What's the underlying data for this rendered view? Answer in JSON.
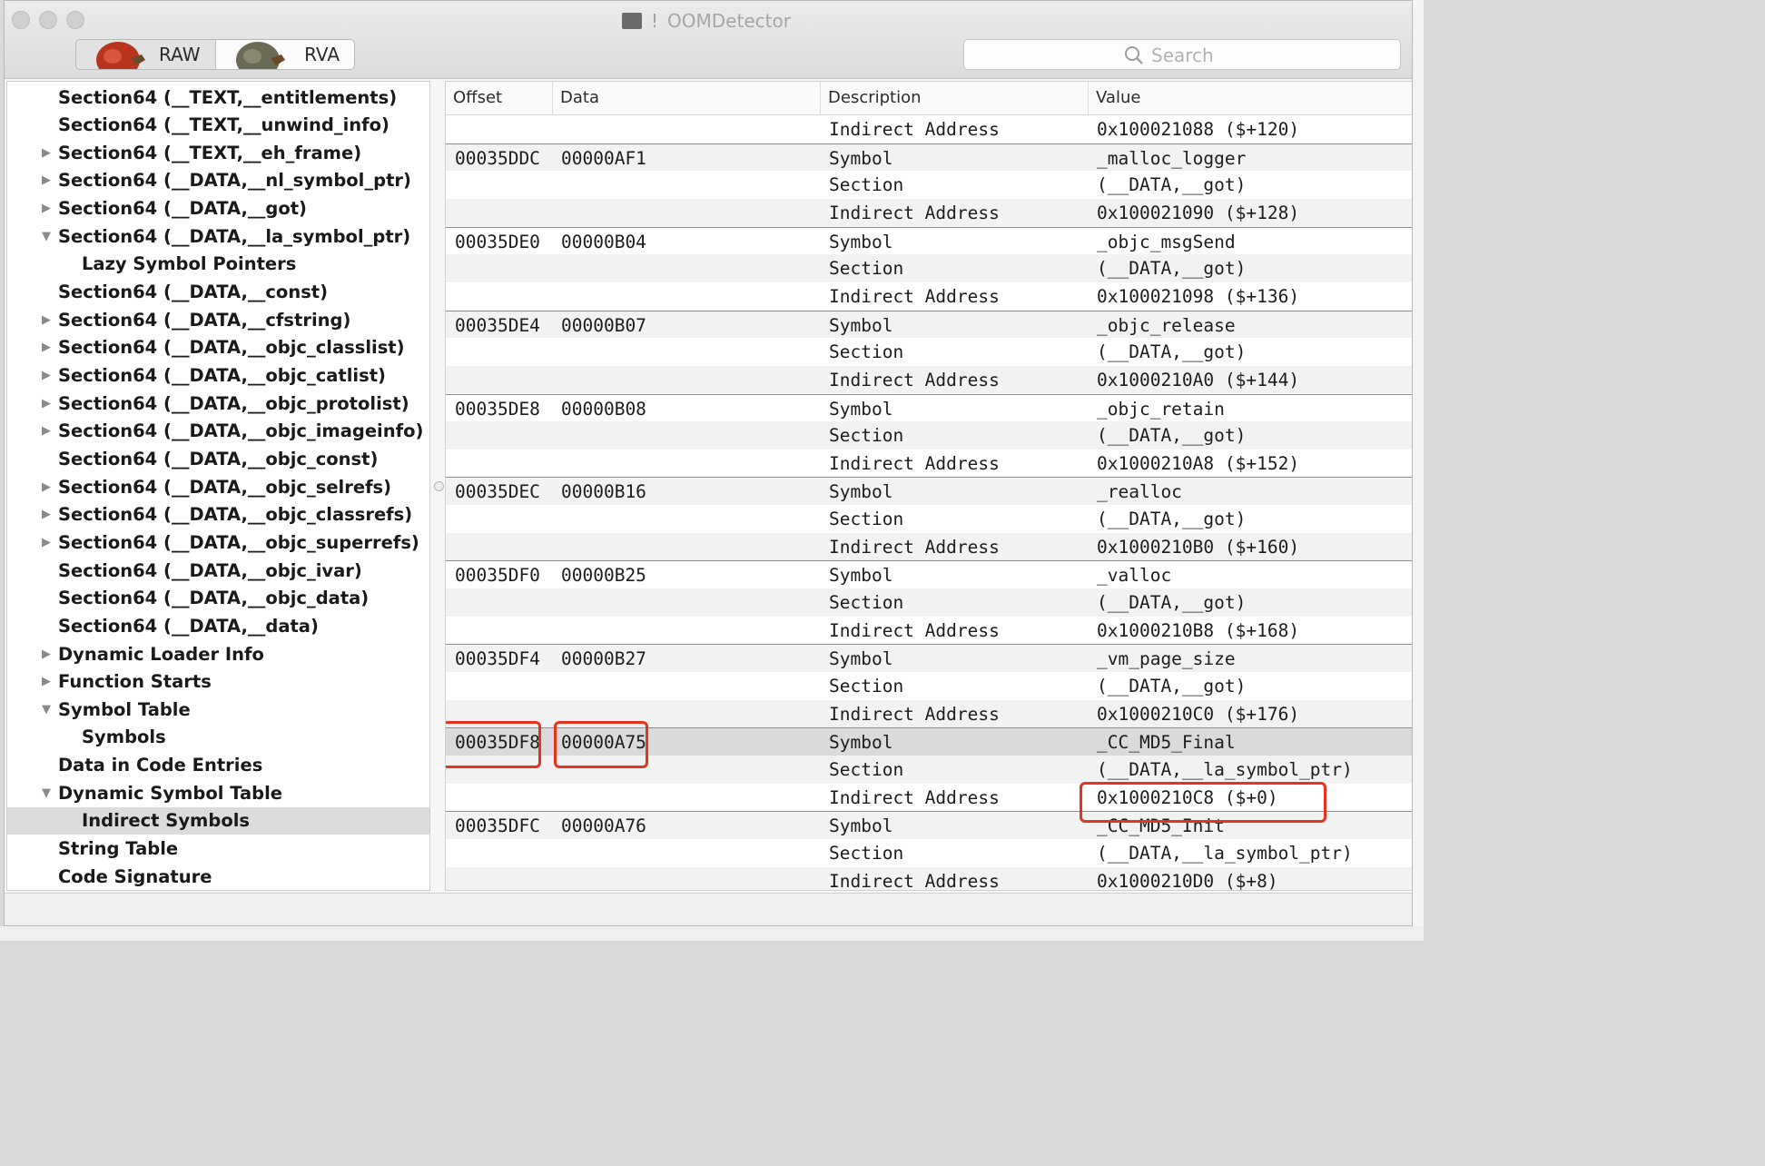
{
  "window": {
    "title": "OOMDetector",
    "title_mark": "!"
  },
  "toolbar": {
    "segments": [
      {
        "label": "RAW",
        "selected": true
      },
      {
        "label": "RVA",
        "selected": false
      }
    ],
    "search_placeholder": "Search"
  },
  "sidebar": {
    "items": [
      {
        "label": "Section64 (__TEXT,__entitlements)",
        "indent": 1,
        "disclosure": "none"
      },
      {
        "label": "Section64 (__TEXT,__unwind_info)",
        "indent": 1,
        "disclosure": "none"
      },
      {
        "label": "Section64 (__TEXT,__eh_frame)",
        "indent": 1,
        "disclosure": "collapsed"
      },
      {
        "label": "Section64 (__DATA,__nl_symbol_ptr)",
        "indent": 1,
        "disclosure": "collapsed"
      },
      {
        "label": "Section64 (__DATA,__got)",
        "indent": 1,
        "disclosure": "collapsed"
      },
      {
        "label": "Section64 (__DATA,__la_symbol_ptr)",
        "indent": 1,
        "disclosure": "expanded"
      },
      {
        "label": "Lazy Symbol Pointers",
        "indent": 2,
        "disclosure": "none"
      },
      {
        "label": "Section64 (__DATA,__const)",
        "indent": 1,
        "disclosure": "none"
      },
      {
        "label": "Section64 (__DATA,__cfstring)",
        "indent": 1,
        "disclosure": "collapsed"
      },
      {
        "label": "Section64 (__DATA,__objc_classlist)",
        "indent": 1,
        "disclosure": "collapsed"
      },
      {
        "label": "Section64 (__DATA,__objc_catlist)",
        "indent": 1,
        "disclosure": "collapsed"
      },
      {
        "label": "Section64 (__DATA,__objc_protolist)",
        "indent": 1,
        "disclosure": "collapsed"
      },
      {
        "label": "Section64 (__DATA,__objc_imageinfo)",
        "indent": 1,
        "disclosure": "collapsed"
      },
      {
        "label": "Section64 (__DATA,__objc_const)",
        "indent": 1,
        "disclosure": "none"
      },
      {
        "label": "Section64 (__DATA,__objc_selrefs)",
        "indent": 1,
        "disclosure": "collapsed"
      },
      {
        "label": "Section64 (__DATA,__objc_classrefs)",
        "indent": 1,
        "disclosure": "collapsed"
      },
      {
        "label": "Section64 (__DATA,__objc_superrefs)",
        "indent": 1,
        "disclosure": "collapsed"
      },
      {
        "label": "Section64 (__DATA,__objc_ivar)",
        "indent": 1,
        "disclosure": "none"
      },
      {
        "label": "Section64 (__DATA,__objc_data)",
        "indent": 1,
        "disclosure": "none"
      },
      {
        "label": "Section64 (__DATA,__data)",
        "indent": 1,
        "disclosure": "none"
      },
      {
        "label": "Dynamic Loader Info",
        "indent": 1,
        "disclosure": "collapsed"
      },
      {
        "label": "Function Starts",
        "indent": 1,
        "disclosure": "collapsed"
      },
      {
        "label": "Symbol Table",
        "indent": 1,
        "disclosure": "expanded"
      },
      {
        "label": "Symbols",
        "indent": 2,
        "disclosure": "none"
      },
      {
        "label": "Data in Code Entries",
        "indent": 1,
        "disclosure": "none"
      },
      {
        "label": "Dynamic Symbol Table",
        "indent": 1,
        "disclosure": "expanded"
      },
      {
        "label": "Indirect Symbols",
        "indent": 2,
        "disclosure": "none",
        "selected": true
      },
      {
        "label": "String Table",
        "indent": 1,
        "disclosure": "none"
      },
      {
        "label": "Code Signature",
        "indent": 1,
        "disclosure": "none"
      }
    ]
  },
  "table": {
    "columns": [
      "Offset",
      "Data",
      "Description",
      "Value"
    ],
    "rows": [
      {
        "offset": "",
        "data": "",
        "desc": "Indirect Address",
        "value": "0x100021088 ($+120)"
      },
      {
        "offset": "00035DDC",
        "data": "00000AF1",
        "desc": "Symbol",
        "value": "_malloc_logger"
      },
      {
        "offset": "",
        "data": "",
        "desc": "Section",
        "value": "(__DATA,__got)"
      },
      {
        "offset": "",
        "data": "",
        "desc": "Indirect Address",
        "value": "0x100021090 ($+128)"
      },
      {
        "offset": "00035DE0",
        "data": "00000B04",
        "desc": "Symbol",
        "value": "_objc_msgSend"
      },
      {
        "offset": "",
        "data": "",
        "desc": "Section",
        "value": "(__DATA,__got)"
      },
      {
        "offset": "",
        "data": "",
        "desc": "Indirect Address",
        "value": "0x100021098 ($+136)"
      },
      {
        "offset": "00035DE4",
        "data": "00000B07",
        "desc": "Symbol",
        "value": "_objc_release"
      },
      {
        "offset": "",
        "data": "",
        "desc": "Section",
        "value": "(__DATA,__got)"
      },
      {
        "offset": "",
        "data": "",
        "desc": "Indirect Address",
        "value": "0x1000210A0 ($+144)"
      },
      {
        "offset": "00035DE8",
        "data": "00000B08",
        "desc": "Symbol",
        "value": "_objc_retain"
      },
      {
        "offset": "",
        "data": "",
        "desc": "Section",
        "value": "(__DATA,__got)"
      },
      {
        "offset": "",
        "data": "",
        "desc": "Indirect Address",
        "value": "0x1000210A8 ($+152)"
      },
      {
        "offset": "00035DEC",
        "data": "00000B16",
        "desc": "Symbol",
        "value": "_realloc"
      },
      {
        "offset": "",
        "data": "",
        "desc": "Section",
        "value": "(__DATA,__got)"
      },
      {
        "offset": "",
        "data": "",
        "desc": "Indirect Address",
        "value": "0x1000210B0 ($+160)"
      },
      {
        "offset": "00035DF0",
        "data": "00000B25",
        "desc": "Symbol",
        "value": "_valloc"
      },
      {
        "offset": "",
        "data": "",
        "desc": "Section",
        "value": "(__DATA,__got)"
      },
      {
        "offset": "",
        "data": "",
        "desc": "Indirect Address",
        "value": "0x1000210B8 ($+168)"
      },
      {
        "offset": "00035DF4",
        "data": "00000B27",
        "desc": "Symbol",
        "value": "_vm_page_size"
      },
      {
        "offset": "",
        "data": "",
        "desc": "Section",
        "value": "(__DATA,__got)"
      },
      {
        "offset": "",
        "data": "",
        "desc": "Indirect Address",
        "value": "0x1000210C0 ($+176)"
      },
      {
        "offset": "00035DF8",
        "data": "00000A75",
        "desc": "Symbol",
        "value": "_CC_MD5_Final",
        "selected": true
      },
      {
        "offset": "",
        "data": "",
        "desc": "Section",
        "value": "(__DATA,__la_symbol_ptr)"
      },
      {
        "offset": "",
        "data": "",
        "desc": "Indirect Address",
        "value": "0x1000210C8 ($+0)"
      },
      {
        "offset": "00035DFC",
        "data": "00000A76",
        "desc": "Symbol",
        "value": "_CC_MD5_Init"
      },
      {
        "offset": "",
        "data": "",
        "desc": "Section",
        "value": "(__DATA,__la_symbol_ptr)"
      },
      {
        "offset": "",
        "data": "",
        "desc": "Indirect Address",
        "value": "0x1000210D0 ($+8)"
      }
    ]
  },
  "colors": {
    "highlight_box": "#e5331e",
    "selected_row": "#dadada"
  }
}
